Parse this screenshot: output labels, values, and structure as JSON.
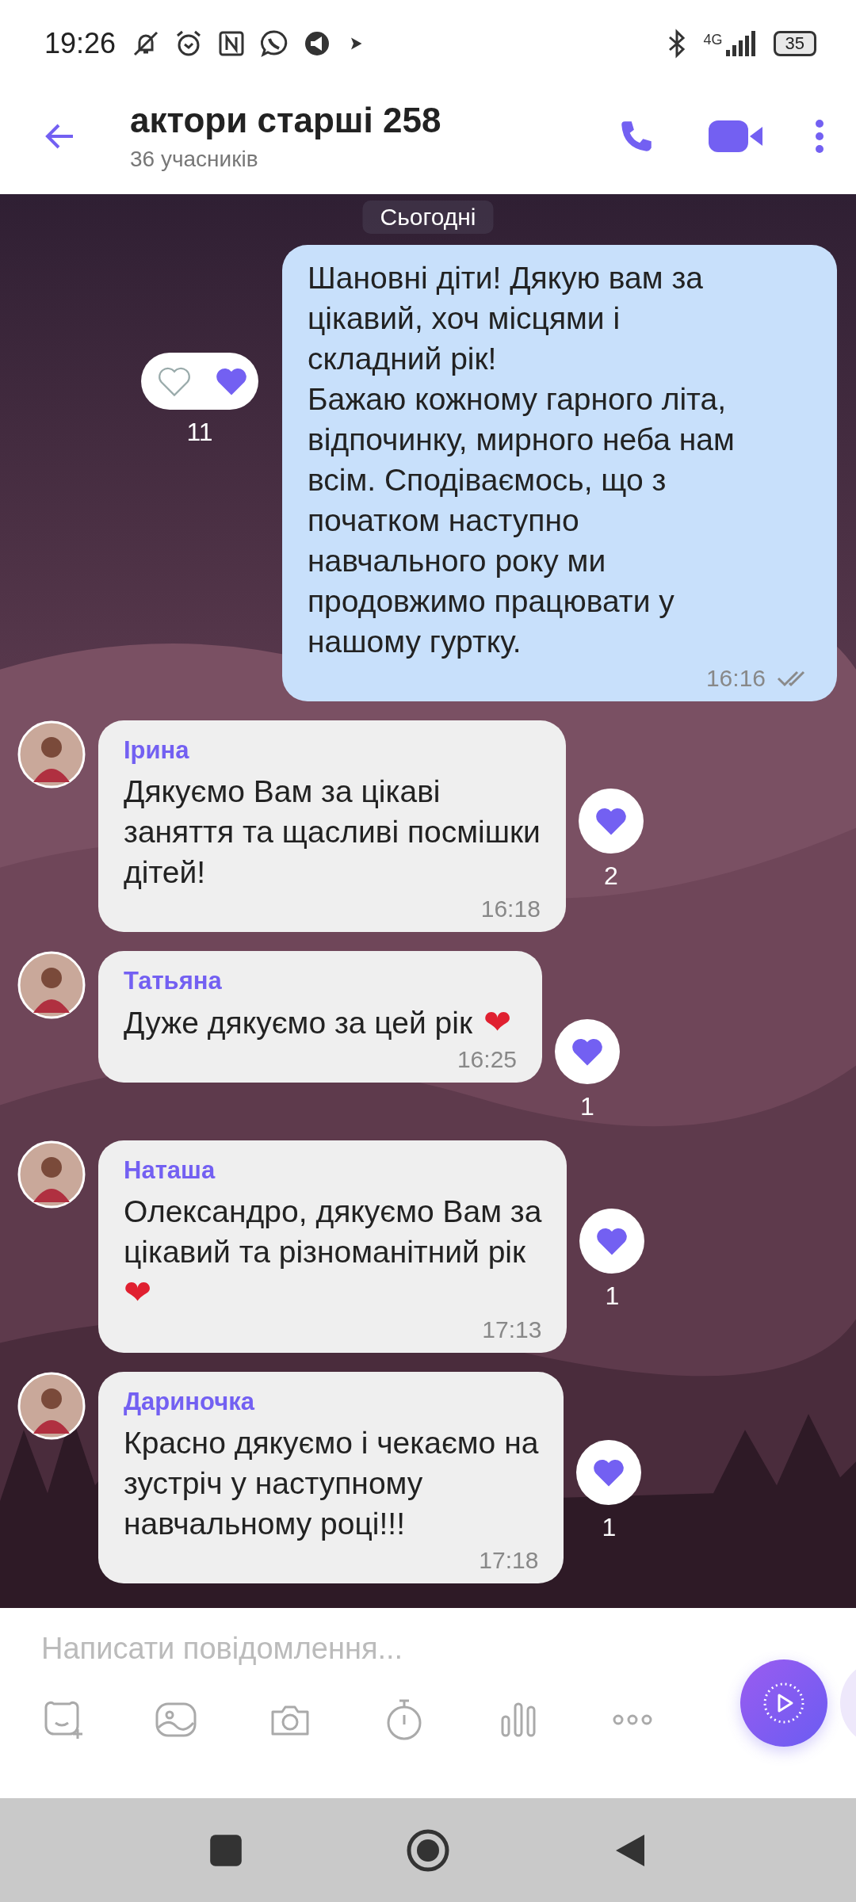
{
  "status_bar": {
    "time": "19:26",
    "network": "4G",
    "battery": "35"
  },
  "header": {
    "title": "актори старші 258",
    "subtitle": "36 учасників"
  },
  "date_label": "Сьогодні",
  "messages": [
    {
      "kind": "outgoing",
      "lines": [
        "Шановні діти! Дякую вам за",
        "цікавий, хоч місцями і",
        "складний рік!",
        "Бажаю кожному гарного літа,",
        "відпочинку, мирного неба нам",
        "всім. Сподіваємось, що з",
        "початком наступно",
        "навчального року ми",
        "продовжимо працювати у",
        "нашому гуртку."
      ],
      "time": "16:16",
      "reaction": {
        "kind": "pair",
        "count": "11"
      }
    },
    {
      "kind": "incoming",
      "sender": "Ірина",
      "lines": [
        "Дякуємо Вам за цікаві",
        "заняття та щасливі посмішки",
        "дітей!"
      ],
      "time": "16:18",
      "reaction": {
        "kind": "single",
        "count": "2"
      }
    },
    {
      "kind": "incoming",
      "sender": "Татьяна",
      "lines": [
        "Дуже дякуємо за цей рік"
      ],
      "emoji": "❤",
      "emoji_newline": false,
      "time": "16:25",
      "reaction": {
        "kind": "single",
        "count": "1"
      }
    },
    {
      "kind": "incoming",
      "sender": "Наташа",
      "lines": [
        "Олександро, дякуємо Вам за",
        "цікавий та різноманітний рік"
      ],
      "emoji": "❤",
      "emoji_newline": true,
      "time": "17:13",
      "reaction": {
        "kind": "single",
        "count": "1"
      }
    },
    {
      "kind": "incoming",
      "sender": "Дариночка",
      "lines": [
        "Красно дякуємо і чекаємо на",
        "зустріч у наступному",
        "навчальному році!!!"
      ],
      "time": "17:18",
      "reaction": {
        "kind": "single",
        "count": "1"
      }
    }
  ],
  "composer": {
    "placeholder": "Написати повідомлення..."
  }
}
